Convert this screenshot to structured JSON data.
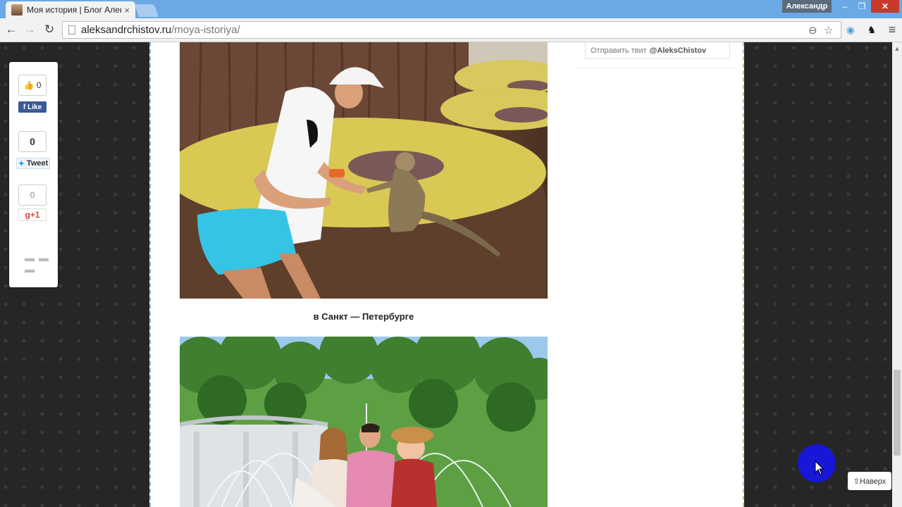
{
  "browser": {
    "tab_title": "Моя история | Блог Алек",
    "tab_close": "×",
    "user_name": "Александр",
    "window": {
      "minimize": "‒",
      "maximize": "❐",
      "close": "✕"
    },
    "nav": {
      "back": "←",
      "forward": "→",
      "reload": "↻"
    },
    "url_host": "aleksandrchistov.ru",
    "url_path": "/moya-istoriya/",
    "icons": {
      "zoom": "⊖",
      "star": "☆",
      "ext1": "◉",
      "ext2": "♞",
      "menu": "≡"
    }
  },
  "share": {
    "fb_count": "0",
    "fb_label": "Like",
    "tw_count": "0",
    "tw_label": "Tweet",
    "gp_count": "0",
    "gp_label": "g+1",
    "more": "▬ ▬ ▬"
  },
  "article": {
    "caption": "в Санкт — Петербурге"
  },
  "sidebar": {
    "tweet_prefix": "Отправить твит",
    "tweet_handle": "@AleksChistov"
  },
  "to_top": "⇧Наверх",
  "colors": {
    "titlebar": "#6aa8e6",
    "fb": "#3b5998",
    "close": "#c7392b",
    "cursor_highlight": "#1717d8"
  }
}
